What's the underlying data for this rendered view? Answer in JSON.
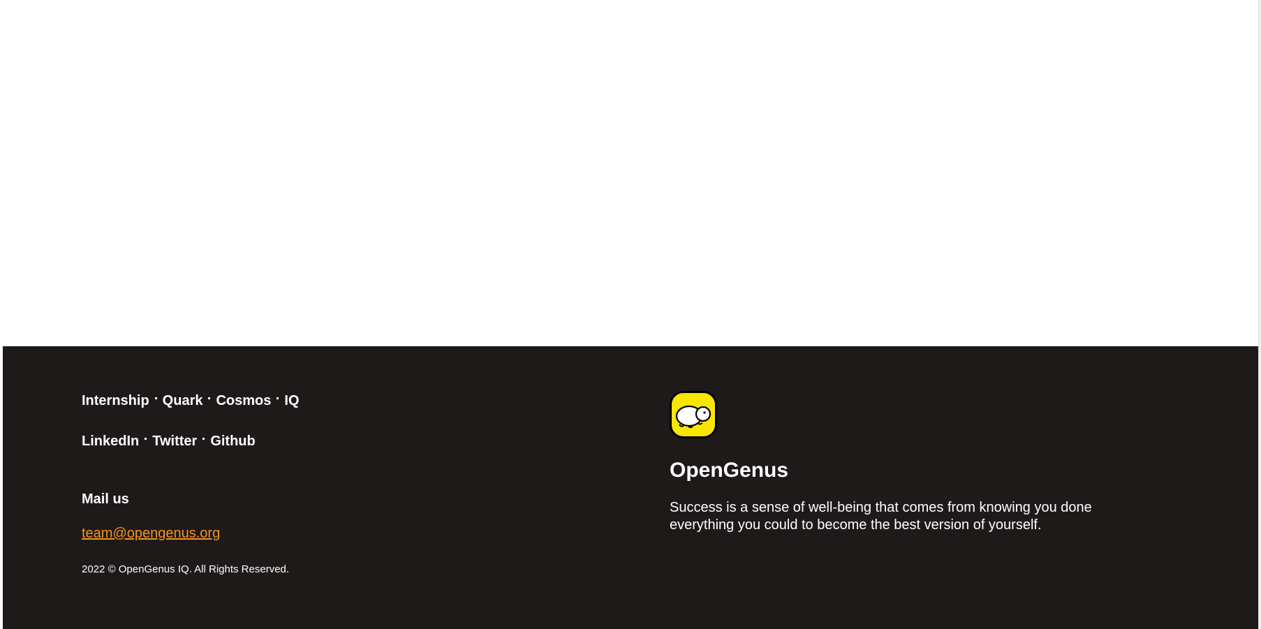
{
  "footer": {
    "product_links": [
      {
        "label": "Internship"
      },
      {
        "label": "Quark"
      },
      {
        "label": "Cosmos"
      },
      {
        "label": "IQ"
      }
    ],
    "social_links": [
      {
        "label": "LinkedIn"
      },
      {
        "label": "Twitter"
      },
      {
        "label": "Github"
      }
    ],
    "mail_heading": "Mail us",
    "mail_address": "team@opengenus.org",
    "copyright": "2022 © OpenGenus IQ. All Rights Reserved.",
    "brand": {
      "logo_icon": "opengenus-logo-icon",
      "name": "OpenGenus",
      "tagline": "Success is a sense of well-being that comes from knowing you done everything you could to become the best version of yourself."
    },
    "colors": {
      "background": "#1e1a1a",
      "text": "#ffffff",
      "mail_link": "#f39422",
      "logo_yellow": "#f7e600"
    }
  }
}
